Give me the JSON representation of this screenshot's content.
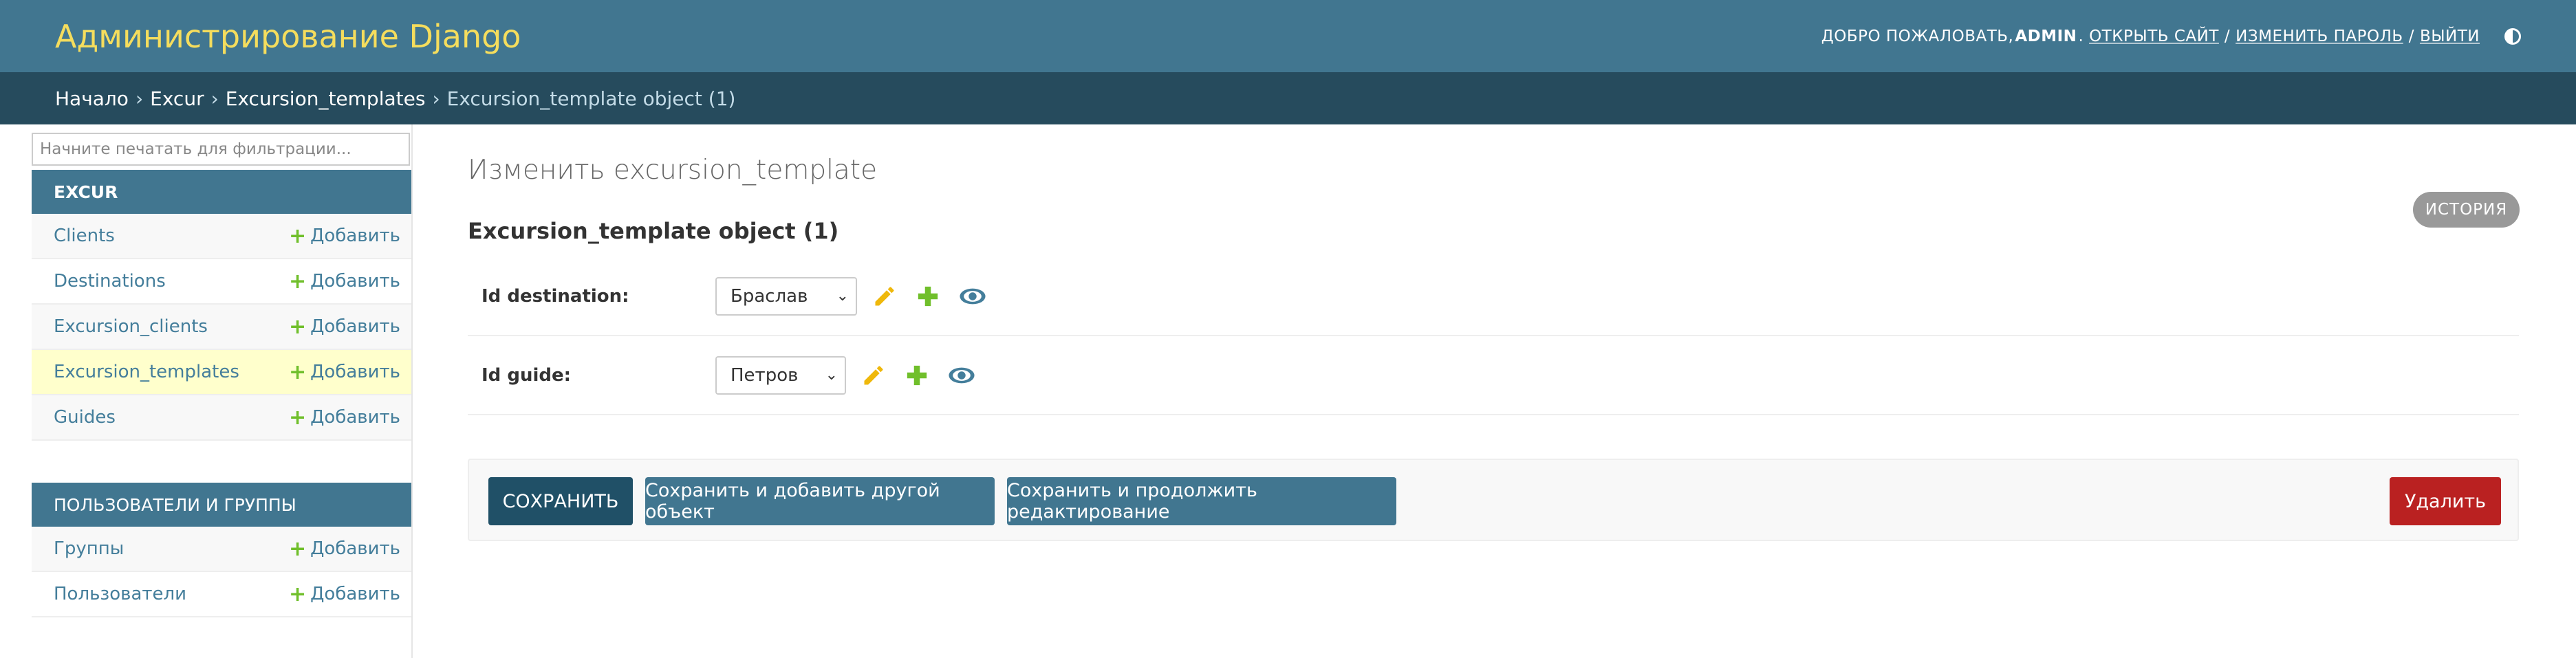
{
  "header": {
    "title": "Администрирование Django",
    "welcome": "ДОБРО ПОЖАЛОВАТЬ,",
    "username": "ADMIN",
    "view_site": "ОТКРЫТЬ САЙТ",
    "change_password": "ИЗМЕНИТЬ ПАРОЛЬ",
    "logout": "ВЫЙТИ",
    "separator": "/",
    "theme_icon": "contrast-toggle-icon"
  },
  "breadcrumbs": {
    "items": [
      "Начало",
      "Excur",
      "Excursion_templates"
    ],
    "current": "Excursion_template object (1)",
    "separator": "›"
  },
  "sidebar": {
    "filter_placeholder": "Начните печатать для фильтрации...",
    "modules": [
      {
        "caption": "EXCUR",
        "models": [
          {
            "name": "Clients",
            "add": "Добавить"
          },
          {
            "name": "Destinations",
            "add": "Добавить"
          },
          {
            "name": "Excursion_clients",
            "add": "Добавить"
          },
          {
            "name": "Excursion_templates",
            "add": "Добавить",
            "selected": true
          },
          {
            "name": "Guides",
            "add": "Добавить"
          }
        ]
      },
      {
        "caption": "ПОЛЬЗОВАТЕЛИ И ГРУППЫ",
        "models": [
          {
            "name": "Группы",
            "add": "Добавить"
          },
          {
            "name": "Пользователи",
            "add": "Добавить"
          }
        ]
      }
    ]
  },
  "main": {
    "page_title": "Изменить excursion_template",
    "object_title": "Excursion_template object (1)",
    "history_button": "ИСТОРИЯ",
    "fields": [
      {
        "label": "Id destination:",
        "value": "Браслав"
      },
      {
        "label": "Id guide:",
        "value": "Петров"
      }
    ],
    "buttons": {
      "save": "СОХРАНИТЬ",
      "save_add_another": "Сохранить и добавить другой объект",
      "save_continue": "Сохранить и продолжить редактирование",
      "delete": "Удалить"
    }
  },
  "colors": {
    "header_bg": "#417690",
    "brand": "#f5dd5d",
    "breadcrumbs_bg": "#264b5d",
    "selected_row": "#ffffcc",
    "add_plus": "#70bf2b",
    "delete": "#ba2121"
  }
}
